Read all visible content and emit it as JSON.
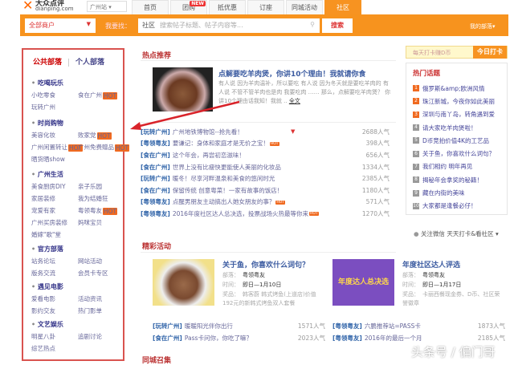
{
  "header": {
    "logo_cn": "大众点评",
    "logo_en": "dianping.com",
    "city": "广州站",
    "nav": [
      {
        "label": "首页"
      },
      {
        "label": "团购",
        "badge": "NEW"
      },
      {
        "label": "抵优惠"
      },
      {
        "label": "订座"
      },
      {
        "label": "同城活动"
      },
      {
        "label": "社区",
        "active": true
      }
    ]
  },
  "searchbar": {
    "category": "全部商户",
    "want_label": "我要找：",
    "scope": "社区",
    "placeholder": "搜索帖子标题、帖子内容等...",
    "button": "搜索",
    "mine": "我的部落"
  },
  "sidebar": {
    "tabs": [
      "公共部落",
      "个人部落"
    ],
    "hot_badge": "HOT",
    "groups": [
      {
        "title": "吃喝玩乐",
        "items": [
          {
            "label": "小吃零食"
          },
          {
            "label": "食在广州",
            "hot": true
          },
          {
            "label": "玩转广州"
          }
        ]
      },
      {
        "title": "时尚购物",
        "items": [
          {
            "label": "美容化妆"
          },
          {
            "label": "败家党",
            "hot": true
          },
          {
            "label": "广州闲置转让",
            "hot": true
          },
          {
            "label": "广州免费赠品",
            "hot": true
          },
          {
            "label": "晒货晒show"
          }
        ]
      },
      {
        "title": "广州生活",
        "items": [
          {
            "label": "美食厨房DIY"
          },
          {
            "label": "亲子乐园"
          },
          {
            "label": "家居装修"
          },
          {
            "label": "我为结婚狂"
          },
          {
            "label": "宠爱有家"
          },
          {
            "label": "粤领粤友",
            "hot": true
          },
          {
            "label": "广州买房装修"
          },
          {
            "label": "妈咪宝贝"
          },
          {
            "label": "婚嫁\"歌\"堂"
          }
        ]
      },
      {
        "title": "官方部落",
        "items": [
          {
            "label": "站务论坛"
          },
          {
            "label": "网站活动"
          },
          {
            "label": "版务交流"
          },
          {
            "label": "会员卡专区"
          }
        ]
      },
      {
        "title": "遇见电影",
        "items": [
          {
            "label": "爱看电影"
          },
          {
            "label": "活动资讯"
          },
          {
            "label": "影约交友"
          },
          {
            "label": "热门影单"
          }
        ]
      },
      {
        "title": "文艺娱乐",
        "items": [
          {
            "label": "明星八卦"
          },
          {
            "label": "追剧讨论"
          },
          {
            "label": "综艺热点"
          }
        ]
      }
    ]
  },
  "hot": {
    "section": "热点推荐",
    "feature": {
      "title": "点解要吃羊肉煲，你讲10个理由！我就请你食",
      "desc": "有人说 因为羊肉温补，所以要吃 有人说 因为冬天就是要吃羊肉的 有人说 不管不管羊肉也是肉 我要吃肉 …… 那么，点解要吃羊肉煲？ 你讲10个理由话我知！我就 ..",
      "more": "全文"
    },
    "rows": [
      {
        "tag": "[玩转广州]",
        "title": "广州地铁博物馆--抢先看！",
        "count": "2688人气",
        "hot": false
      },
      {
        "tag": "[粤领粤友]",
        "title": "要谦记：身体和家庭才是无价之宝！",
        "count": "398人气",
        "hot": true
      },
      {
        "tag": "[食在广州]",
        "title": "这个年会，再尝初恋滋味！",
        "count": "656人气",
        "hot": false
      },
      {
        "tag": "[食在广州]",
        "title": "世界上没有比瘦快更能使人美丽的化妆品",
        "count": "1334人气",
        "hot": false
      },
      {
        "tag": "[玩转广州]",
        "title": "暖冬！尽享河畔温泉和美食的悠闲时光",
        "count": "2385人气",
        "hot": false
      },
      {
        "tag": "[食在广州]",
        "title": "保留传统 创意粤菜！一家有故事的饭店！",
        "count": "1180人气",
        "hot": false
      },
      {
        "tag": "[粤领粤友]",
        "title": "点醒男朋友主动搞出人她女朋友的事？",
        "count": "571人气",
        "hot": true
      },
      {
        "tag": "[粤领粤友]",
        "title": "2016年度社区达人总决选，投票战场火热最等你来",
        "count": "1270人气",
        "hot": true
      }
    ]
  },
  "events": {
    "section": "精彩活动",
    "labels": {
      "tribe": "部落：",
      "time": "时间：",
      "prize": "奖品："
    },
    "items": [
      {
        "title": "关于鱼，你喜欢什么词句？",
        "tribe": "粤领粤友",
        "time": "即日—1月10日",
        "prize": "韩客蔚 韩式烤鱼(上道店)价值192元的新韩式烤鱼双人套餐"
      },
      {
        "title": "年度社区达人评选",
        "tribe": "粤领粤友",
        "time": "即日—1月17日",
        "prize": "卡丽西餐现金券、D币、社区荣誉徽章",
        "banner": "年度达人总决选"
      }
    ],
    "rows": [
      {
        "tag": "[玩转广州]",
        "title": "暖暖阳光伴你出行",
        "count": "1571人气"
      },
      {
        "tag": "[粤领粤友]",
        "title": "六鹏推荐站=PASS卡",
        "count": "1873人气"
      },
      {
        "tag": "[食在广州]",
        "title": "Pass卡问你，你吃了嘛？",
        "count": "2023人气"
      },
      {
        "tag": "[粤领粤友]",
        "title": "2016年的最后一个月",
        "count": "2185人气"
      }
    ]
  },
  "nearby": {
    "section": "同城召集"
  },
  "right": {
    "checkin_label": "每天打卡赚D币",
    "checkin_button": "今日打卡",
    "hot_topics_title": "热门话题",
    "topics": [
      "俄罗斯&amp;欧洲风情",
      "珠江新城，今夜你如此美丽",
      "深圳与南丫岛，转角遇到爱",
      "请大家吃羊肉煲啦！",
      "D币竞拍价值4K的工艺品",
      "关于鱼，你喜欢什么词句？",
      "我们相约 明年再见",
      "揭秘年会拿奖的秘籍！",
      "藏在内街的美味",
      "大家都是逢餐必仔！"
    ],
    "wechat": "关注微信 天天打卡&看社区"
  },
  "watermark": "头条号 / 偏门哥",
  "colors": {
    "orange": "#f7931e",
    "red_highlight": "#d9534f",
    "link": "#3a5aa0"
  }
}
